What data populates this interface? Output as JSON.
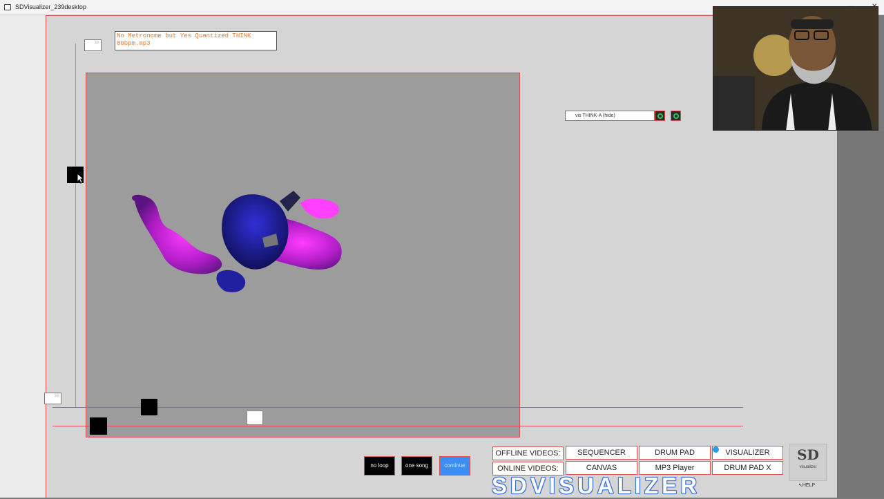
{
  "window": {
    "title": "SDVisualizer_239desktop"
  },
  "song": {
    "filename": "No Metronome  but  Yes Quantized  THINK\n80bpm.mp3"
  },
  "markers": {
    "top_value": "1b",
    "bottom_value": "16"
  },
  "vis_panel": {
    "label": "vis THINK-A (hide)"
  },
  "playback": {
    "no_loop": "no loop",
    "one_song": "one song",
    "continue": "continue"
  },
  "nav": {
    "offline_label": "OFFLINE VIDEOS:",
    "online_label": "ONLINE VIDEOS:",
    "sequencer": "SEQUENCER",
    "drum_pad": "DRUM PAD",
    "visualizer": "VISUALIZER",
    "canvas": "CANVAS",
    "mp3_player": "MP3 Player",
    "drum_pad_x": "DRUM PAD X"
  },
  "brand": {
    "text": "SDVISUALIZER"
  },
  "logo": {
    "mark": "SD",
    "sub": "visualizer"
  },
  "help": {
    "text": "HELP"
  },
  "colors": {
    "accent_red": "#e05050",
    "continue_blue": "#3d8ef0",
    "vis_green": "#3ac24a",
    "song_text": "#e07a2a"
  },
  "icons": [
    "app-icon",
    "minimize-icon",
    "maximize-icon",
    "close-icon",
    "eye-icon",
    "zoom-icon",
    "mouse-cursor-icon",
    "check-icon"
  ]
}
